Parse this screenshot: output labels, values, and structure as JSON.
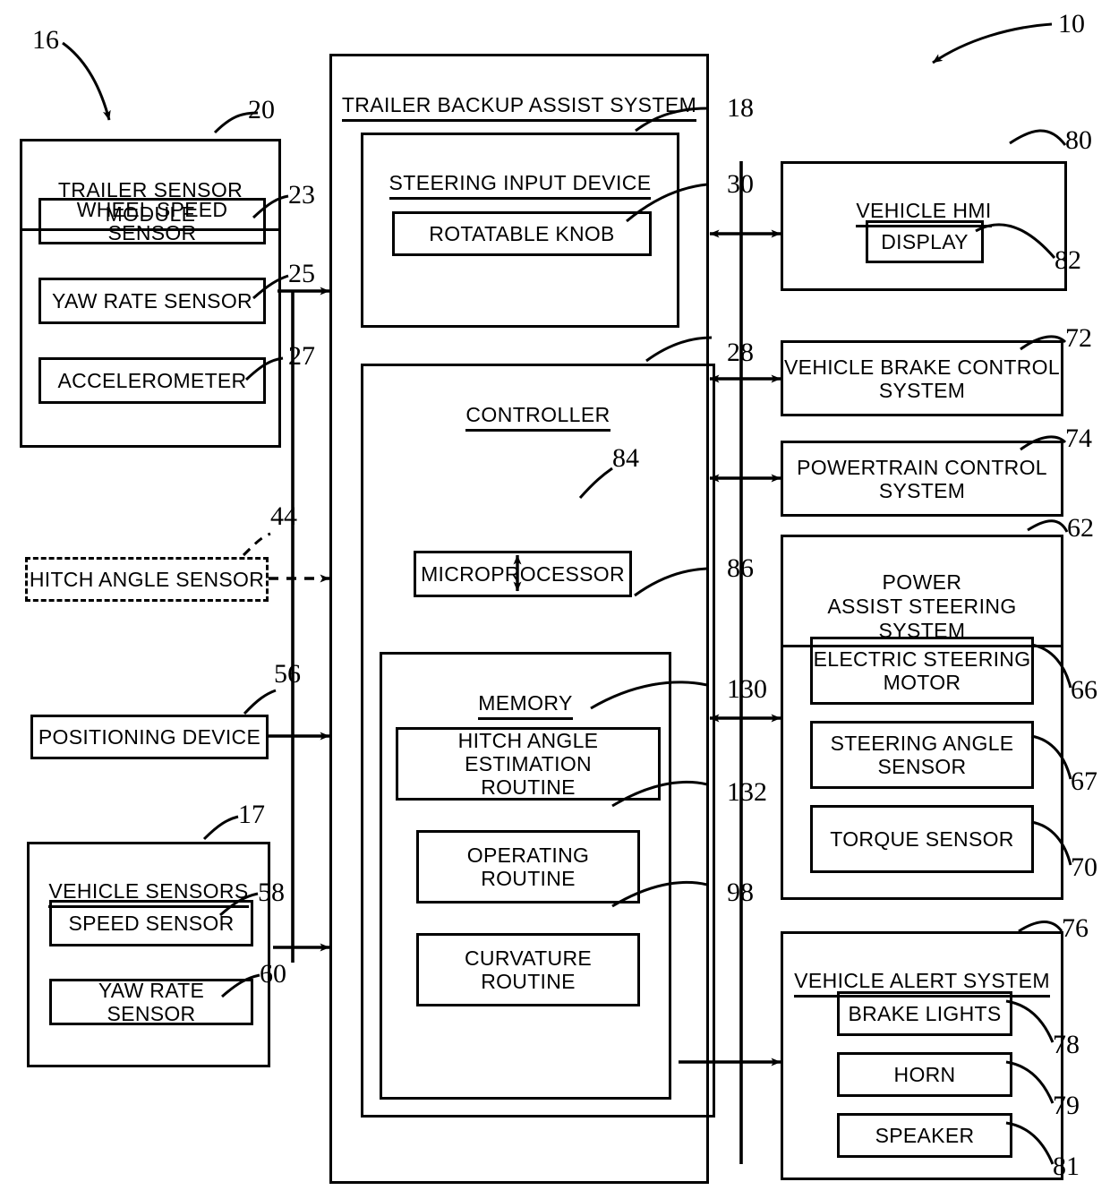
{
  "figure": {
    "system_ref": "10",
    "left_group_ref": "16"
  },
  "left_column": {
    "trailer_sensor_module": {
      "title": "TRAILER SENSOR MODULE",
      "ref": "20",
      "items": [
        {
          "label": "WHEEL SPEED SENSOR",
          "ref": "23"
        },
        {
          "label": "YAW RATE SENSOR",
          "ref": "25"
        },
        {
          "label": "ACCELEROMETER",
          "ref": "27"
        }
      ]
    },
    "hitch_angle_sensor": {
      "label": "HITCH ANGLE SENSOR",
      "ref": "44",
      "style": "dashed"
    },
    "positioning_device": {
      "label": "POSITIONING DEVICE",
      "ref": "56"
    },
    "vehicle_sensors": {
      "title": "VEHICLE SENSORS",
      "ref": "17",
      "items": [
        {
          "label": "SPEED SENSOR",
          "ref": "58"
        },
        {
          "label": "YAW RATE SENSOR",
          "ref": "60"
        }
      ]
    }
  },
  "center": {
    "system_title": "TRAILER BACKUP ASSIST SYSTEM",
    "steering_input_device": {
      "title": "STEERING INPUT DEVICE",
      "ref": "18",
      "knob": {
        "label": "ROTATABLE KNOB",
        "ref": "30"
      }
    },
    "controller": {
      "title": "CONTROLLER",
      "ref": "28",
      "microprocessor": {
        "label": "MICROPROCESSOR",
        "ref": "84"
      },
      "memory": {
        "title": "MEMORY",
        "ref": "86",
        "routines": [
          {
            "label": "HITCH ANGLE ESTIMATION\nROUTINE",
            "ref": "130"
          },
          {
            "label": "OPERATING\nROUTINE",
            "ref": "132"
          },
          {
            "label": "CURVATURE\nROUTINE",
            "ref": "98"
          }
        ]
      }
    }
  },
  "right_column": {
    "vehicle_hmi": {
      "title": "VEHICLE HMI",
      "ref": "80",
      "display": {
        "label": "DISPLAY",
        "ref": "82"
      }
    },
    "vehicle_brake_control_system": {
      "label": "VEHICLE BRAKE CONTROL\nSYSTEM",
      "ref": "72"
    },
    "powertrain_control_system": {
      "label": "POWERTRAIN CONTROL\nSYSTEM",
      "ref": "74"
    },
    "power_assist_steering_system": {
      "title": "POWER\nASSIST STEERING SYSTEM",
      "ref": "62",
      "items": [
        {
          "label": "ELECTRIC STEERING\nMOTOR",
          "ref": "66"
        },
        {
          "label": "STEERING ANGLE\nSENSOR",
          "ref": "67"
        },
        {
          "label": "TORQUE SENSOR",
          "ref": "70"
        }
      ]
    },
    "vehicle_alert_system": {
      "title": "VEHICLE ALERT SYSTEM",
      "ref": "76",
      "items": [
        {
          "label": "BRAKE LIGHTS",
          "ref": "78"
        },
        {
          "label": "HORN",
          "ref": "79"
        },
        {
          "label": "SPEAKER",
          "ref": "81"
        }
      ]
    }
  }
}
